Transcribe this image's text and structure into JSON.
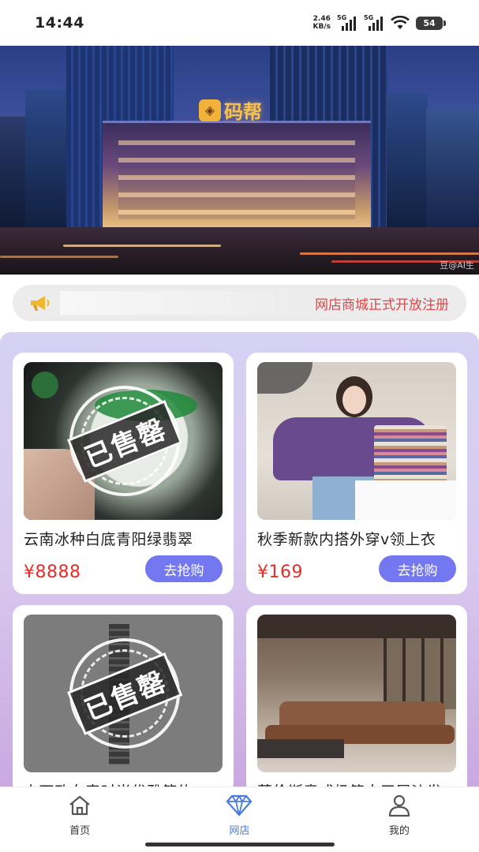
{
  "status_bar": {
    "time": "14:44",
    "net_speed_value": "2.46",
    "net_speed_unit": "KB/s",
    "sim1_label": "5G",
    "sim2_label": "5G",
    "battery": "54"
  },
  "hero": {
    "logo_text": "码帮",
    "watermark": "豆@AI生"
  },
  "notice": {
    "icon": "megaphone-icon",
    "text": "网店商城正式开放注册"
  },
  "products": [
    {
      "title": "云南冰种白底青阳绿翡翠",
      "price": "¥8888",
      "button": "去抢购",
      "sold": true,
      "sold_label": "已售罄"
    },
    {
      "title": "秋季新款内搭外穿v领上衣",
      "price": "¥169",
      "button": "去抢购",
      "sold": false
    },
    {
      "title": "卡西欧女表时尚优雅简约",
      "price": "",
      "button": "",
      "sold": true,
      "sold_label": "已售罄"
    },
    {
      "title": "莫伦斯意式极简大平层沙发",
      "price": "",
      "button": "",
      "sold": false
    }
  ],
  "bottom_nav": {
    "items": [
      {
        "label": "首页",
        "icon": "home-icon",
        "active": false
      },
      {
        "label": "网店",
        "icon": "diamond-icon",
        "active": true
      },
      {
        "label": "我的",
        "icon": "user-icon",
        "active": false
      }
    ]
  },
  "colors": {
    "accent": "#7378f0",
    "price": "#e0302c",
    "notice_text": "#e0474a",
    "nav_active": "#4a7be0"
  }
}
